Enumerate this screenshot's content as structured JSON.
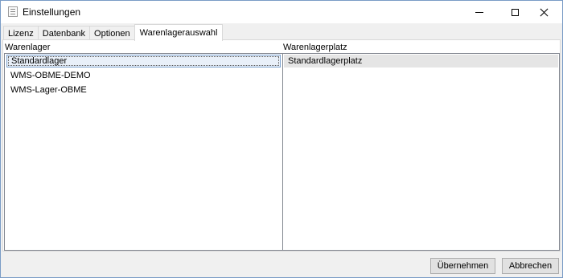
{
  "window": {
    "title": "Einstellungen"
  },
  "tabs": [
    {
      "label": "Lizenz"
    },
    {
      "label": "Datenbank"
    },
    {
      "label": "Optionen"
    },
    {
      "label": "Warenlagerauswahl",
      "active": true
    }
  ],
  "warehouse_list": {
    "header": "Warenlager",
    "items": [
      "Standardlager",
      "WMS-OBME-DEMO",
      "WMS-Lager-OBME"
    ],
    "selected_index": 0
  },
  "location_list": {
    "header": "Warenlagerplatz",
    "items": [
      "Standardlagerplatz"
    ]
  },
  "buttons": {
    "apply": "Übernehmen",
    "cancel": "Abbrechen"
  }
}
